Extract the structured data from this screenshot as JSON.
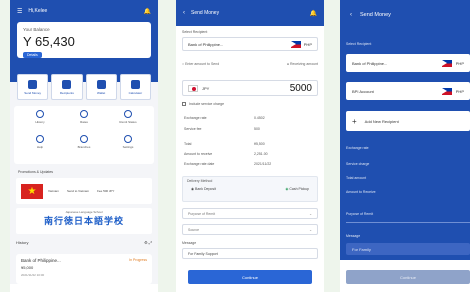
{
  "home": {
    "app_title": "Hi,Kelee",
    "balance_label": "Your Balance",
    "balance": "Y 65,430",
    "balance_button": "Details",
    "tiles": [
      "Send Money",
      "Recipients",
      "Wallet",
      "Calculator"
    ],
    "menu": [
      "History",
      "Rates",
      "Remit Status",
      "Help",
      "Branches",
      "Settings"
    ],
    "promo_title": "Promotions & Updates",
    "banner_country": "Vietnam",
    "banner_caption": "Send to Vietnam",
    "banner_note": "Fee 500 JPY",
    "banner2_small": "Japanese Language School",
    "banner2_big": "南行徳日本語学校",
    "history_title": "History",
    "tx_name": "Bank of Philippine...",
    "tx_amount": "¥5,000",
    "tx_status": "In Progress",
    "tx_time": "2021/11/22 10:00"
  },
  "send": {
    "title": "Send Money",
    "recipient_label": "Select Recipient",
    "recipient_name": "Bank of Philippine...",
    "recipient_code": "PHP",
    "opt_left": "Enter amount to Send",
    "opt_right": "Receiving amount",
    "currency": "JPY",
    "amount": "5000",
    "checkbox_label": "Include service charge",
    "rows": [
      {
        "k": "Exchange rate",
        "v": "0.4502"
      },
      {
        "k": "Service fee",
        "v": "500"
      },
      {
        "k": "Total",
        "v": "¥5,500"
      },
      {
        "k": "Amount to receive",
        "v": "2,251.00"
      },
      {
        "k": "Exchange rate date",
        "v": "2021/11/22"
      }
    ],
    "delivery_label": "Delivery Method",
    "delivery_left": "Bank Deposit",
    "delivery_right": "Cash Pickup",
    "purpose_placeholder": "Purpose of Remit",
    "source_placeholder": "Source",
    "message_label": "Message",
    "message_value": "For Family Support",
    "continue_label": "Continue"
  },
  "review": {
    "title": "Send Money",
    "recipients_label": "Select Recipient",
    "recipient1": "Bank of Philippine...",
    "recipient1_code": "PHP",
    "recipient2": "BPI Account",
    "recipient2_code": "PHP",
    "add_label": "Add New Recipient",
    "fields": [
      "Exchange rate",
      "Service charge",
      "Total amount",
      "Amount to Receive"
    ],
    "purpose_label": "Purpose of Remit",
    "message_label": "Message",
    "message_value": "For Family",
    "cta": "Continue"
  },
  "colors": {
    "primary": "#1f4fb0",
    "accent": "#2a66d6"
  }
}
